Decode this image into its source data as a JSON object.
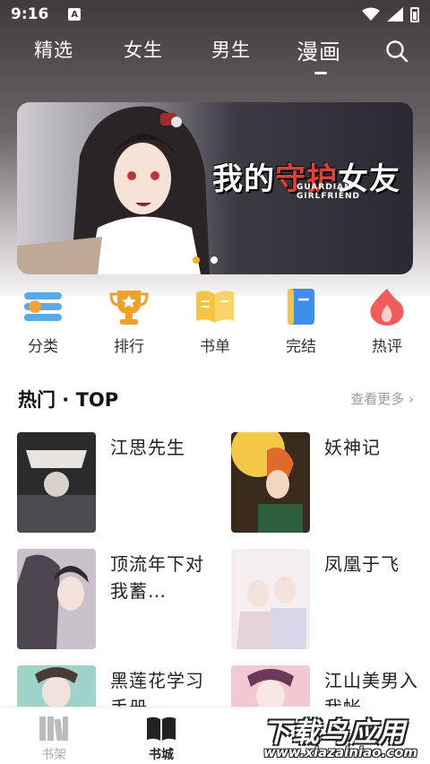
{
  "status_bar": {
    "time": "9:16",
    "notification_badge": "A"
  },
  "top_nav": {
    "tabs": [
      {
        "label": "精选",
        "active": false
      },
      {
        "label": "女生",
        "active": false
      },
      {
        "label": "男生",
        "active": false
      },
      {
        "label": "漫画",
        "active": true
      }
    ],
    "search_icon": "search-icon"
  },
  "banner": {
    "title_cn_part1": "我的",
    "title_cn_part2": "守护",
    "title_cn_part3": "女友",
    "title_en": "GUARDIAN GIRLFRIEND",
    "page_count": 2,
    "active_page": 1
  },
  "categories": [
    {
      "label": "分类",
      "icon": "category-icon",
      "color": "#5aa8e6"
    },
    {
      "label": "排行",
      "icon": "trophy-icon",
      "color": "#f0a12a"
    },
    {
      "label": "书单",
      "icon": "open-book-icon",
      "color": "#f5c542"
    },
    {
      "label": "完结",
      "icon": "finished-book-icon",
      "color": "#3f8ee8"
    },
    {
      "label": "热评",
      "icon": "flame-icon",
      "color": "#f25c5c"
    }
  ],
  "hot_section": {
    "title": "热门 · TOP",
    "see_more": "查看更多"
  },
  "books": [
    {
      "title": "江思先生"
    },
    {
      "title": "妖神记"
    },
    {
      "title": "顶流年下对我蓄…"
    },
    {
      "title": "凤凰于飞"
    },
    {
      "title": "黑莲花学习手册"
    },
    {
      "title": "江山美男入我帐"
    }
  ],
  "bottom_tabs": [
    {
      "label": "书架",
      "active": false
    },
    {
      "label": "书城",
      "active": true
    }
  ],
  "watermark": {
    "cn": "下载鸟应用",
    "en": "www.xiazainiao.com"
  },
  "colors": {
    "accent_dot": "#f2b61c",
    "header_dark": "#3f3a3e"
  }
}
